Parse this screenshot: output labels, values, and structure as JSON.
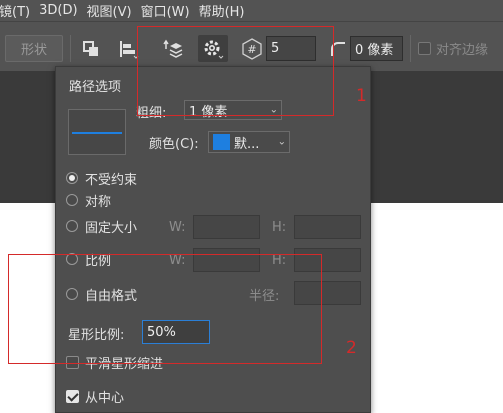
{
  "menubar": {
    "items": [
      "镜(T)",
      "3D(D)",
      "视图(V)",
      "窗口(W)",
      "帮助(H)"
    ]
  },
  "options_bar": {
    "shape_label": "形状",
    "sides_value": "5",
    "radius_value": "0 像素",
    "align_edges_label": "对齐边缘"
  },
  "panel": {
    "path_options_title": "路径选项",
    "stroke_width_label": "粗细:",
    "stroke_width_value": "1 像素",
    "color_label": "颜色(C):",
    "color_value": "默...",
    "color_swatch": "#1e7fe0",
    "radio_unconstrained": "不受约束",
    "radio_square": "对称",
    "radio_fixed_size": "固定大小",
    "radio_proportional": "比例",
    "radio_from_center_free": "自由格式",
    "w_label": "W:",
    "h_label": "H:",
    "radius_label": "半径:",
    "star_ratio_label": "星形比例:",
    "star_ratio_value": "50%",
    "smooth_indent_label": "平滑星形缩进",
    "from_center_label": "从中心"
  },
  "annotations": {
    "label_1": "1",
    "label_2": "2",
    "color": "#d42a2a"
  }
}
